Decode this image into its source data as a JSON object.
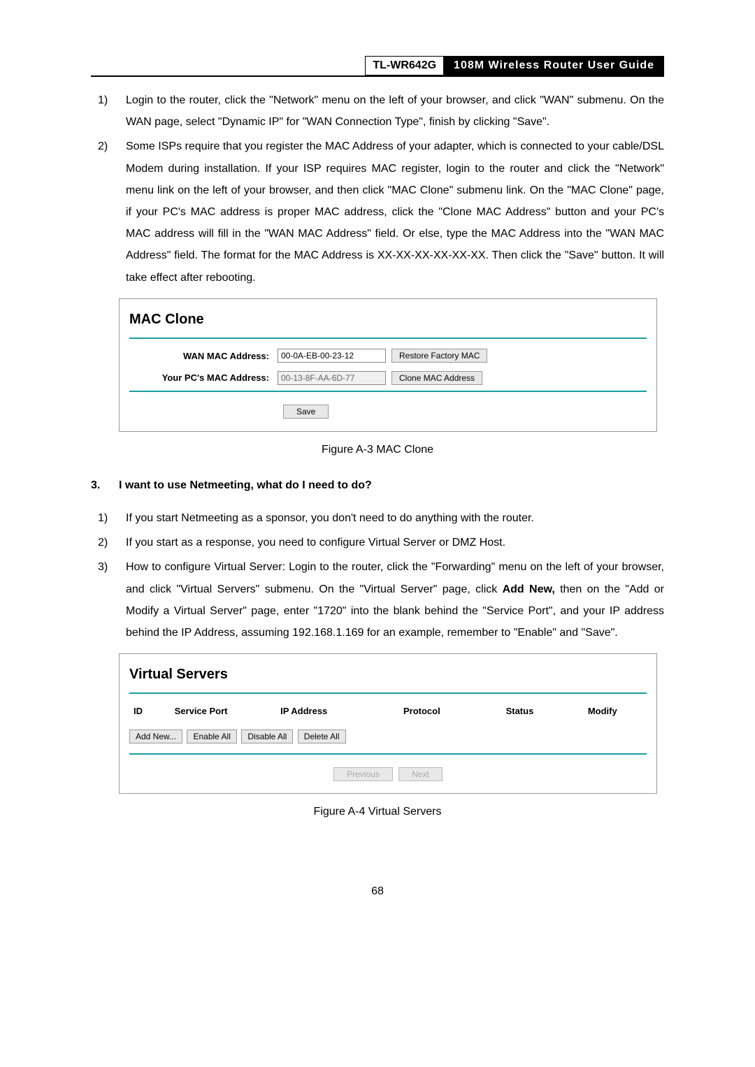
{
  "header": {
    "model": "TL-WR642G",
    "title": "108M  Wireless  Router  User  Guide"
  },
  "steps_a": {
    "item1_num": "1)",
    "item1_text": "Login to the router, click the \"Network\" menu on the left of your browser, and click \"WAN\" submenu. On the WAN page, select \"Dynamic IP\" for \"WAN Connection Type\", finish by clicking \"Save\".",
    "item2_num": "2)",
    "item2_text": "Some ISPs require that you register the MAC Address of your adapter, which is connected to your cable/DSL Modem during installation. If your ISP requires MAC register, login to the router and click the \"Network\" menu link on the left of your browser, and then click \"MAC Clone\" submenu link. On the \"MAC Clone\" page, if your PC's MAC address is proper MAC address, click the \"Clone MAC Address\" button and your PC's MAC address will fill in the \"WAN MAC Address\" field. Or else, type the MAC Address into the \"WAN MAC Address\" field. The format for the MAC Address is XX-XX-XX-XX-XX-XX. Then click the \"Save\" button. It will take effect after rebooting."
  },
  "mac_clone": {
    "title": "MAC Clone",
    "wan_label": "WAN MAC Address:",
    "wan_value": "00-0A-EB-00-23-12",
    "restore_btn": "Restore Factory MAC",
    "pc_label": "Your PC's MAC Address:",
    "pc_value": "00-13-8F-AA-6D-77",
    "clone_btn": "Clone MAC Address",
    "save_btn": "Save",
    "caption": "Figure A-3    MAC Clone"
  },
  "section3": {
    "num": "3.",
    "heading": "I want to use Netmeeting, what do I need to do?",
    "item1_num": "1)",
    "item1_text": "If you start Netmeeting as a sponsor, you don't need to do anything with the router.",
    "item2_num": "2)",
    "item2_text": "If you start as a response, you need to configure Virtual Server or DMZ Host.",
    "item3_num": "3)",
    "item3_text_a": "How to configure Virtual Server: Login to the router, click the \"Forwarding\" menu on the left of your browser, and click \"Virtual Servers\" submenu. On the \"Virtual Server\" page, click ",
    "item3_bold": "Add New,",
    "item3_text_b": " then on the \"Add or Modify a Virtual Server\" page,   enter \"1720\" into the blank behind the \"Service Port\", and your IP address behind the IP Address, assuming 192.168.1.169 for an example, remember to \"Enable\" and \"Save\"."
  },
  "virtual_servers": {
    "title": "Virtual Servers",
    "cols": {
      "id": "ID",
      "sp": "Service Port",
      "ip": "IP Address",
      "proto": "Protocol",
      "status": "Status",
      "modify": "Modify"
    },
    "btns": {
      "add": "Add New...",
      "enable": "Enable All",
      "disable": "Disable All",
      "delete": "Delete All",
      "prev": "Previous",
      "next": "Next"
    },
    "caption": "Figure A-4    Virtual Servers"
  },
  "page_number": "68"
}
